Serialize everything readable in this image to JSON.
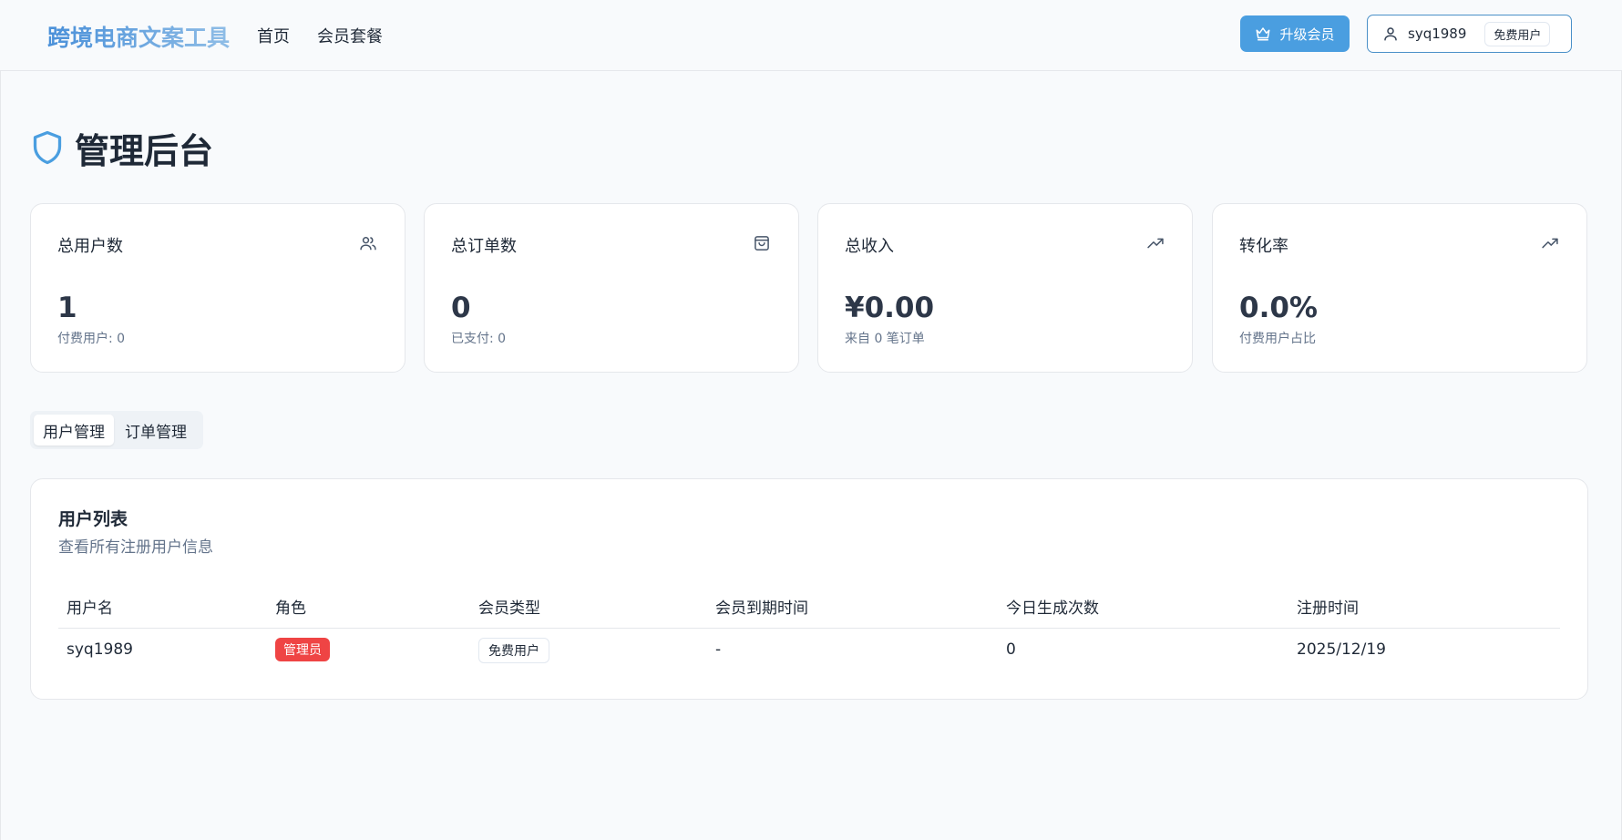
{
  "header": {
    "brand": "跨境电商文案工具",
    "nav": [
      {
        "label": "首页"
      },
      {
        "label": "会员套餐"
      }
    ],
    "upgrade_label": "升级会员",
    "user": {
      "name": "syq1989",
      "tier": "免费用户"
    }
  },
  "page": {
    "title": "管理后台"
  },
  "stats": [
    {
      "label": "总用户数",
      "icon": "users-icon",
      "value": "1",
      "sub": "付费用户: 0"
    },
    {
      "label": "总订单数",
      "icon": "shopping-bag-icon",
      "value": "0",
      "sub": "已支付: 0"
    },
    {
      "label": "总收入",
      "icon": "trending-up-icon",
      "value": "¥0.00",
      "sub": "来自 0 笔订单"
    },
    {
      "label": "转化率",
      "icon": "trending-up-icon",
      "value": "0.0%",
      "sub": "付费用户占比"
    }
  ],
  "tabs": [
    {
      "label": "用户管理",
      "active": true
    },
    {
      "label": "订单管理",
      "active": false
    }
  ],
  "user_table": {
    "title": "用户列表",
    "description": "查看所有注册用户信息",
    "columns": [
      "用户名",
      "角色",
      "会员类型",
      "会员到期时间",
      "今日生成次数",
      "注册时间"
    ],
    "rows": [
      {
        "username": "syq1989",
        "role": "管理员",
        "membership": "免费用户",
        "expiry": "-",
        "today_count": "0",
        "registered": "2025/12/19"
      }
    ]
  },
  "colors": {
    "accent": "#4a9ee0",
    "danger": "#ef4444",
    "muted_text": "#64748b"
  }
}
